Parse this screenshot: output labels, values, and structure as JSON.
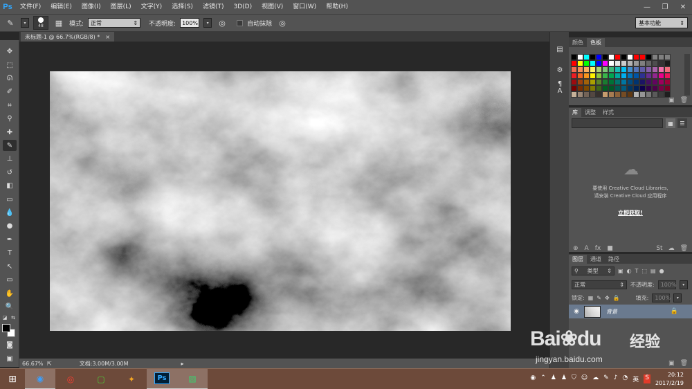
{
  "app": {
    "logo": "Ps"
  },
  "menu": [
    "文件(F)",
    "编辑(E)",
    "图像(I)",
    "图层(L)",
    "文字(Y)",
    "选择(S)",
    "滤镜(T)",
    "3D(D)",
    "视图(V)",
    "窗口(W)",
    "帮助(H)"
  ],
  "window_controls": {
    "minimize": "—",
    "restore": "❐",
    "close": "✕"
  },
  "options": {
    "brush_size": "48",
    "mode_label": "模式:",
    "mode_value": "正常",
    "opacity_label": "不透明度:",
    "opacity_value": "100%",
    "auto_erase_label": "自动抹除",
    "workspace": "基本功能"
  },
  "document": {
    "tab_title": "未标题-1 @ 66.7%(RGB/8) *",
    "tab_close": "×",
    "zoom": "66.67%",
    "doc_info": "文档:3.00M/3.00M"
  },
  "swatches_panel": {
    "tabs": [
      "颜色",
      "色板"
    ],
    "active_tab": 1,
    "colors": [
      "#000000",
      "#ffffff",
      "#00ffff",
      "#000000",
      "#0000ff",
      "#000000",
      "#ffffff",
      "#ff0000",
      "#000000",
      "#ffffff",
      "#ff0000",
      "#ff0000",
      "#000000",
      "#808080",
      "#808080",
      "#808080",
      "#ff0000",
      "#ffff00",
      "#00ff00",
      "#00ffff",
      "#0000ff",
      "#ff00ff",
      "#ffffff",
      "#e6e6e6",
      "#cccccc",
      "#b3b3b3",
      "#999999",
      "#808080",
      "#666666",
      "#4d4d4d",
      "#333333",
      "#1a1a1a",
      "#f26c4f",
      "#f68e56",
      "#fbaf5d",
      "#fff467",
      "#acd372",
      "#7cc576",
      "#3bb878",
      "#1abbb4",
      "#00bff3",
      "#438ccb",
      "#5574b9",
      "#605ca8",
      "#855fa8",
      "#a763a8",
      "#f06ea9",
      "#f26d7d",
      "#ed1c24",
      "#f26522",
      "#f7941d",
      "#fff200",
      "#8dc63f",
      "#39b54a",
      "#00a651",
      "#00a99d",
      "#00aeef",
      "#0072bc",
      "#0054a6",
      "#2e3192",
      "#662d91",
      "#92278f",
      "#ec008c",
      "#ed145b",
      "#9e0b0f",
      "#a0410d",
      "#a36209",
      "#aba000",
      "#598527",
      "#197b30",
      "#007236",
      "#00746b",
      "#0076a3",
      "#004b80",
      "#003471",
      "#1b1464",
      "#440e62",
      "#630460",
      "#9e005d",
      "#9e0039",
      "#790000",
      "#7b2e00",
      "#7d4900",
      "#827b00",
      "#406618",
      "#005e20",
      "#005826",
      "#005952",
      "#005b7f",
      "#003663",
      "#002157",
      "#0d004c",
      "#32004b",
      "#4b0049",
      "#7b0046",
      "#7a0026",
      "#c7b299",
      "#998675",
      "#736357",
      "#534741",
      "#37302d",
      "#c69c6d",
      "#a67c52",
      "#8c6239",
      "#754c24",
      "#603913",
      "#b4b4b4",
      "#969696",
      "#787878",
      "#5a5a5a",
      "#3c3c3c",
      "#1e1e1e"
    ]
  },
  "library_panel": {
    "tabs": [
      "库",
      "调整",
      "样式"
    ],
    "active_tab": 0,
    "line1": "要使用 Creative Cloud Libraries,",
    "line2": "请安装 Creative Cloud 应用程序",
    "link": "立即获取!"
  },
  "layers_panel": {
    "tabs": [
      "图层",
      "通道",
      "路径"
    ],
    "active_tab": 0,
    "filter_type": "类型",
    "blend_mode": "正常",
    "opacity_label": "不透明度:",
    "opacity_value": "100%",
    "lock_label": "锁定:",
    "fill_label": "填充:",
    "fill_value": "100%",
    "layer_name": "背景"
  },
  "taskbar": {
    "ps_label": "Ps",
    "input_method": "英",
    "time": "20:12",
    "date": "2017/2/19"
  },
  "watermark": {
    "logo_left": "Bai",
    "logo_right": "du",
    "cn": "经验",
    "url": "jingyan.baidu.com"
  }
}
